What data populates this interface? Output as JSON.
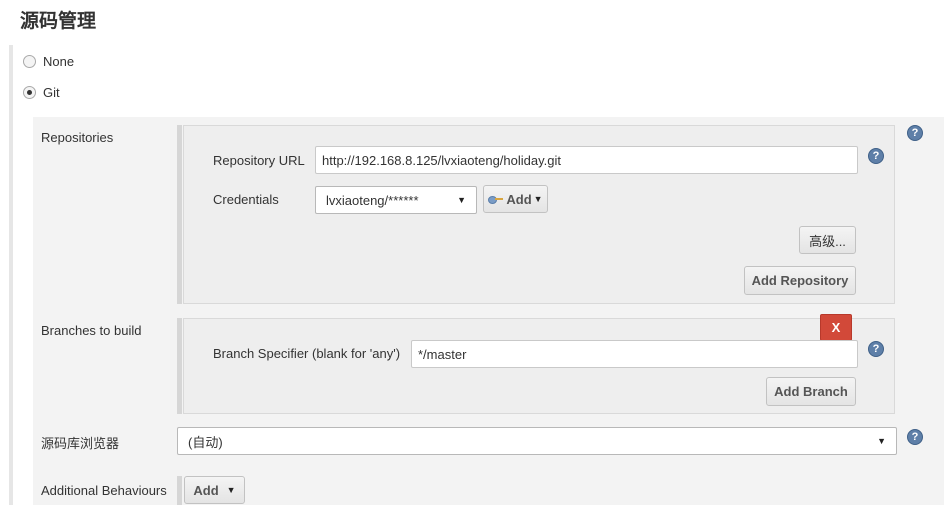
{
  "section": {
    "title": "源码管理"
  },
  "scm_options": [
    {
      "label": "None",
      "selected": false
    },
    {
      "label": "Git",
      "selected": true
    }
  ],
  "repositories": {
    "label": "Repositories",
    "url_label": "Repository URL",
    "url_value": "http://192.168.8.125/lvxiaoteng/holiday.git",
    "credentials_label": "Credentials",
    "credentials_value": "lvxiaoteng/******",
    "add_credentials_label": "Add",
    "advanced_label": "高级...",
    "add_repository_label": "Add Repository"
  },
  "branches": {
    "label": "Branches to build",
    "delete_label": "X",
    "specifier_label": "Branch Specifier (blank for 'any')",
    "specifier_value": "*/master",
    "add_branch_label": "Add Branch"
  },
  "repo_browser": {
    "label": "源码库浏览器",
    "value": "(自动)"
  },
  "behaviours": {
    "label": "Additional Behaviours",
    "add_label": "Add"
  },
  "icons": {
    "help": "help-icon",
    "dropdown": "dropdown-caret-icon",
    "key": "key-icon"
  },
  "help_glyph": "?",
  "caret_glyph": "▼",
  "colors": {
    "delete_button": "#d24939",
    "help_icon": "#5e7fa8",
    "panel_bg": "#eeeeee"
  }
}
